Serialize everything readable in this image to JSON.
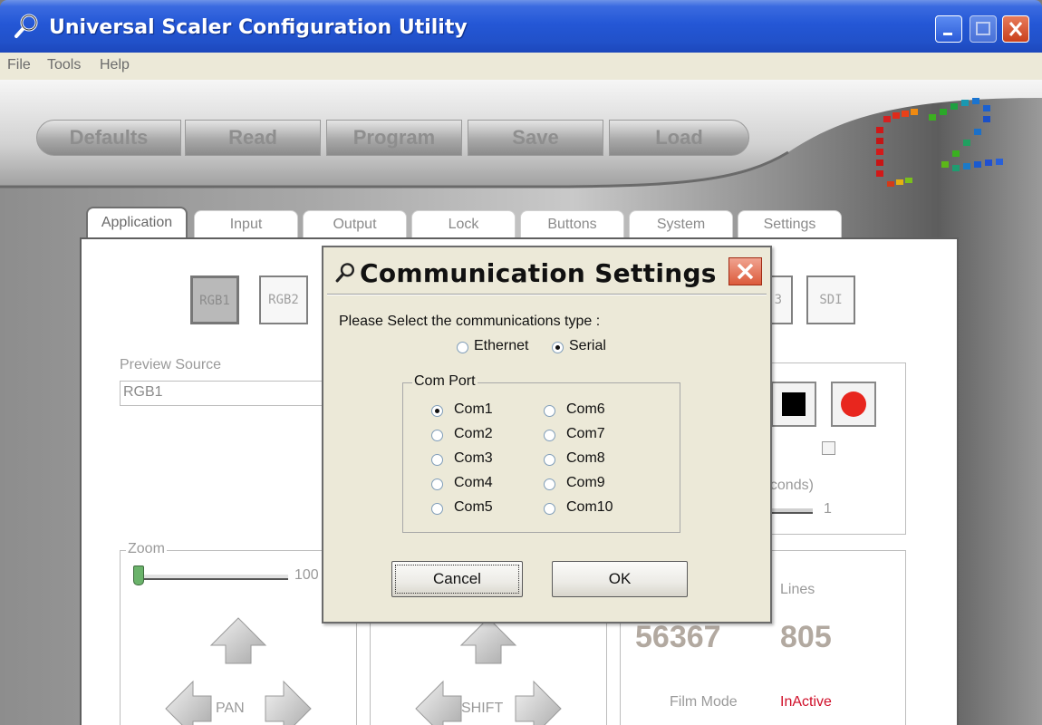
{
  "window": {
    "title": "Universal Scaler Configuration Utility"
  },
  "menu": [
    "File",
    "Tools",
    "Help"
  ],
  "toolbar": [
    "Defaults",
    "Read",
    "Program",
    "Save",
    "Load"
  ],
  "tabs": [
    "Application",
    "Input",
    "Output",
    "Lock",
    "Buttons",
    "System",
    "Settings"
  ],
  "sources": [
    "RGB1",
    "RGB2",
    "3",
    "SDI"
  ],
  "preview": {
    "label": "Preview Source",
    "value": "RGB1"
  },
  "zoom": {
    "label": "Zoom",
    "value": "100"
  },
  "pan_label": "PAN",
  "shift_label": "SHIFT",
  "timer": {
    "partial_label": "econds)",
    "value": "1"
  },
  "stats": {
    "lines_label": "Lines",
    "value1": "56367",
    "value2": "805",
    "film_mode_label": "Film Mode",
    "film_mode_value": "InActive"
  },
  "colors": {
    "film_mode_value": "#d0102a",
    "record": "#e8261e"
  },
  "dialog": {
    "title": "Communication Settings",
    "prompt": "Please Select the communications type :",
    "types": [
      {
        "label": "Ethernet",
        "selected": false
      },
      {
        "label": "Serial",
        "selected": true
      }
    ],
    "group_title": "Com Port",
    "ports_left": [
      {
        "label": "Com1",
        "selected": true
      },
      {
        "label": "Com2",
        "selected": false
      },
      {
        "label": "Com3",
        "selected": false
      },
      {
        "label": "Com4",
        "selected": false
      },
      {
        "label": "Com5",
        "selected": false
      }
    ],
    "ports_right": [
      {
        "label": "Com6",
        "selected": false
      },
      {
        "label": "Com7",
        "selected": false
      },
      {
        "label": "Com8",
        "selected": false
      },
      {
        "label": "Com9",
        "selected": false
      },
      {
        "label": "Com10",
        "selected": false
      }
    ],
    "cancel": "Cancel",
    "ok": "OK"
  }
}
